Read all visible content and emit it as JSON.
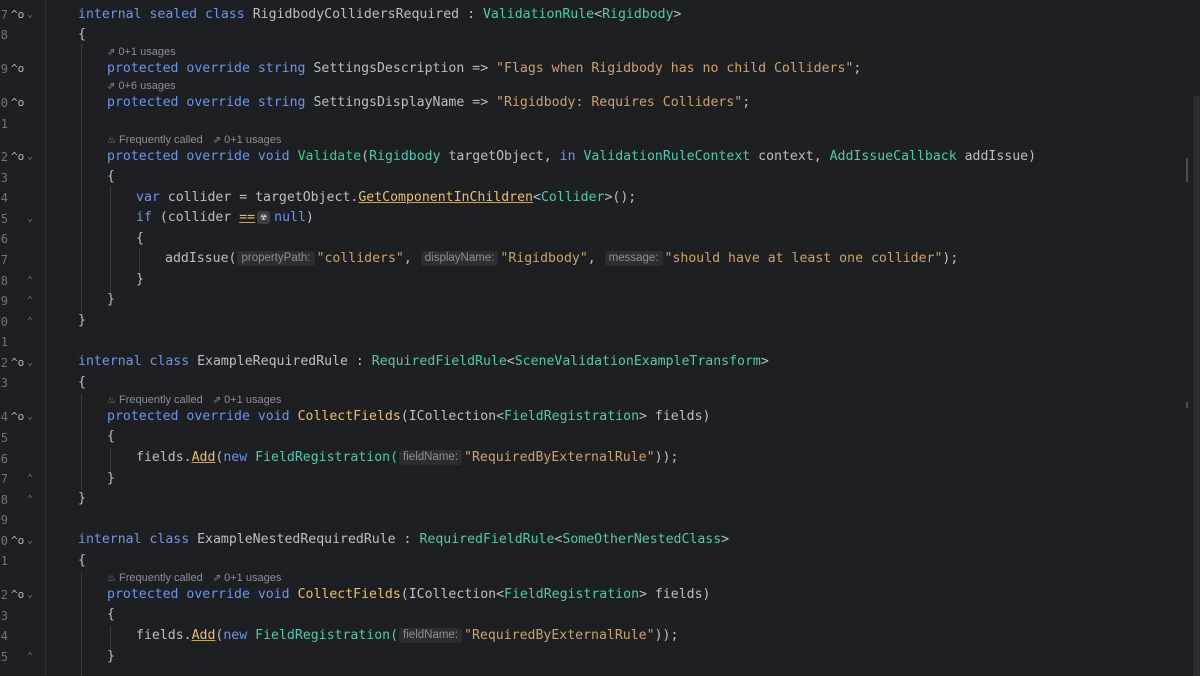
{
  "lines": {
    "l1": {
      "kw1": "internal sealed class",
      "name": "RigidbodyCollidersRequired",
      "sep": " : ",
      "base": "ValidationRule",
      "lt": "<",
      "generic": "Rigidbody",
      "gt": ">"
    },
    "l2": {
      "text": "{"
    },
    "l3": {
      "kw": "protected override string",
      "name": "SettingsDescription",
      "arrow": " => ",
      "str": "\"Flags when Rigidbody has no child Colliders\"",
      "end": ";"
    },
    "l4": {
      "kw": "protected override string",
      "name": "SettingsDisplayName",
      "arrow": " => ",
      "str": "\"Rigidbody: Requires Colliders\"",
      "end": ";"
    },
    "l5": {
      "kw": "protected override void",
      "name": "Validate",
      "p1": "(",
      "t1": "Rigidbody",
      "a1": " targetObject, ",
      "in": "in",
      "t2": "ValidationRuleContext",
      "a2": " context, ",
      "t3": "AddIssueCallback",
      "a3": " addIssue)"
    },
    "l6": {
      "text": "{"
    },
    "l7": {
      "kw": "var",
      "a": " collider = targetObject.",
      "method": "GetComponentInChildren",
      "lt": "<",
      "generic": "Collider",
      "rest": ">();"
    },
    "l8": {
      "kw": "if",
      "a": " (collider ",
      "op": "==",
      "radio": "☢",
      "null": "null",
      "end": ")"
    },
    "l9": {
      "text": "{"
    },
    "l10": {
      "call": "addIssue(",
      "h1": "propertyPath:",
      "s1": "\"colliders\"",
      "c1": ", ",
      "h2": "displayName:",
      "s2": "\"Rigidbody\"",
      "c2": ", ",
      "h3": "message:",
      "s3": "\"should have at least one collider\"",
      "end": ");"
    },
    "l11": {
      "text": "}"
    },
    "l12": {
      "text": "}"
    },
    "l13": {
      "text": "}"
    },
    "l14": {
      "kw": "internal class",
      "name": "ExampleRequiredRule",
      "sep": " : ",
      "base": "RequiredFieldRule",
      "lt": "<",
      "generic": "SceneValidationExampleTransform",
      "gt": ">"
    },
    "l15": {
      "text": "{"
    },
    "l16": {
      "kw": "protected override void",
      "name": "CollectFields",
      "p": "(ICollection",
      "lt": "<",
      "generic": "FieldRegistration",
      "rest": "> fields)"
    },
    "l17": {
      "text": "{"
    },
    "l18": {
      "a": "fields.",
      "method": "Add",
      "p": "(",
      "kw": "new",
      "cls": " FieldRegistration(",
      "hint": "fieldName:",
      "str": "\"RequiredByExternalRule\"",
      "end": "));"
    },
    "l19": {
      "text": "}"
    },
    "l20": {
      "text": "}"
    },
    "l21": {
      "kw": "internal class",
      "name": "ExampleNestedRequiredRule",
      "sep": " : ",
      "base": "RequiredFieldRule",
      "lt": "<",
      "generic": "SomeOtherNestedClass",
      "gt": ">"
    },
    "l22": {
      "text": "{"
    },
    "l23": {
      "kw": "protected override void",
      "name": "CollectFields",
      "p": "(ICollection",
      "lt": "<",
      "generic": "FieldRegistration",
      "rest": "> fields)"
    },
    "l24": {
      "text": "{"
    },
    "l25": {
      "a": "fields.",
      "method": "Add",
      "p": "(",
      "kw": "new",
      "cls": " FieldRegistration(",
      "hint": "fieldName:",
      "str": "\"RequiredByExternalRule\"",
      "end": "));"
    },
    "l26": {
      "text": "}"
    }
  },
  "lenses": {
    "settings_desc_usages": "0+1 usages",
    "settings_name_usages": "0+6 usages",
    "validate_freq": "Frequently called",
    "validate_usages": "0+1 usages",
    "collect1_freq": "Frequently called",
    "collect1_usages": "0+1 usages",
    "collect2_freq": "Frequently called",
    "collect2_usages": "0+1 usages"
  },
  "gutter": {
    "line_numbers": [
      "7",
      "8",
      "9",
      "0",
      "1",
      "2",
      "3",
      "4",
      "5",
      "6",
      "7",
      "8",
      "9",
      "0",
      "1",
      "2",
      "3",
      "4",
      "5",
      "6",
      "7",
      "8",
      "9",
      "0",
      "1",
      "2",
      "3",
      "4",
      "5"
    ]
  },
  "colors": {
    "background": "#1e1f22",
    "keyword": "#6c95eb",
    "string": "#c9a26d",
    "generic": "#4ec9b0",
    "method": "#39cc8f"
  }
}
